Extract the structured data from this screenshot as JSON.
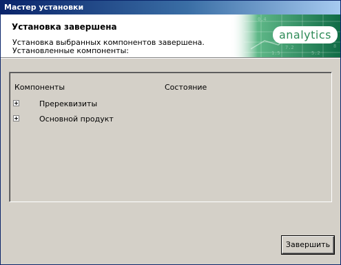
{
  "window": {
    "title": "Мастер установки"
  },
  "header": {
    "title": "Установка завершена",
    "desc_line1": "Установка выбранных компонентов завершена.",
    "desc_line2": "Установленные компоненты:",
    "brand": "analytics"
  },
  "table": {
    "columns": [
      "Компоненты",
      "Состояние"
    ],
    "rows": [
      {
        "label": "Пререквизиты",
        "status": ""
      },
      {
        "label": "Основной продукт",
        "status": ""
      }
    ]
  },
  "buttons": {
    "finish": "Завершить"
  },
  "colors": {
    "banner_green": "#1f8a57",
    "brand_green": "#2e8b57",
    "titlebar": "#0a246a"
  }
}
